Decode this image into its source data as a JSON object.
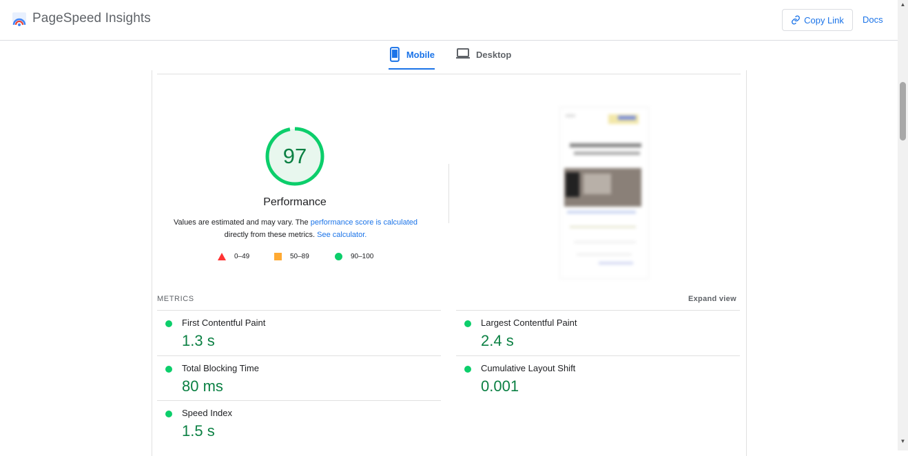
{
  "app": {
    "title": "PageSpeed Insights",
    "copy_link_label": "Copy Link",
    "docs_label": "Docs"
  },
  "tabs": [
    {
      "label": "Mobile",
      "active": true,
      "icon": "mobile-phone-icon"
    },
    {
      "label": "Desktop",
      "active": false,
      "icon": "laptop-icon"
    }
  ],
  "score": {
    "value": "97",
    "fraction": 0.97,
    "title": "Performance",
    "desc_prefix": "Values are estimated and may vary. The ",
    "desc_link": "performance score is calculated",
    "desc_middle": "directly from these metrics. ",
    "desc_link2": "See calculator."
  },
  "legend": [
    {
      "range": "0–49",
      "shape": "triangle",
      "color": "#f33"
    },
    {
      "range": "50–89",
      "shape": "square",
      "color": "#fa3"
    },
    {
      "range": "90–100",
      "shape": "circle",
      "color": "#0cce6b"
    }
  ],
  "metrics": {
    "heading": "METRICS",
    "expand_label": "Expand view",
    "items": [
      {
        "name": "First Contentful Paint",
        "value": "1.3 s"
      },
      {
        "name": "Largest Contentful Paint",
        "value": "2.4 s"
      },
      {
        "name": "Total Blocking Time",
        "value": "80 ms"
      },
      {
        "name": "Cumulative Layout Shift",
        "value": "0.001"
      },
      {
        "name": "Speed Index",
        "value": "1.5 s"
      }
    ]
  },
  "colors": {
    "accent": "#1a73e8",
    "good": "#0cce6b",
    "good_text": "#0b8043"
  }
}
